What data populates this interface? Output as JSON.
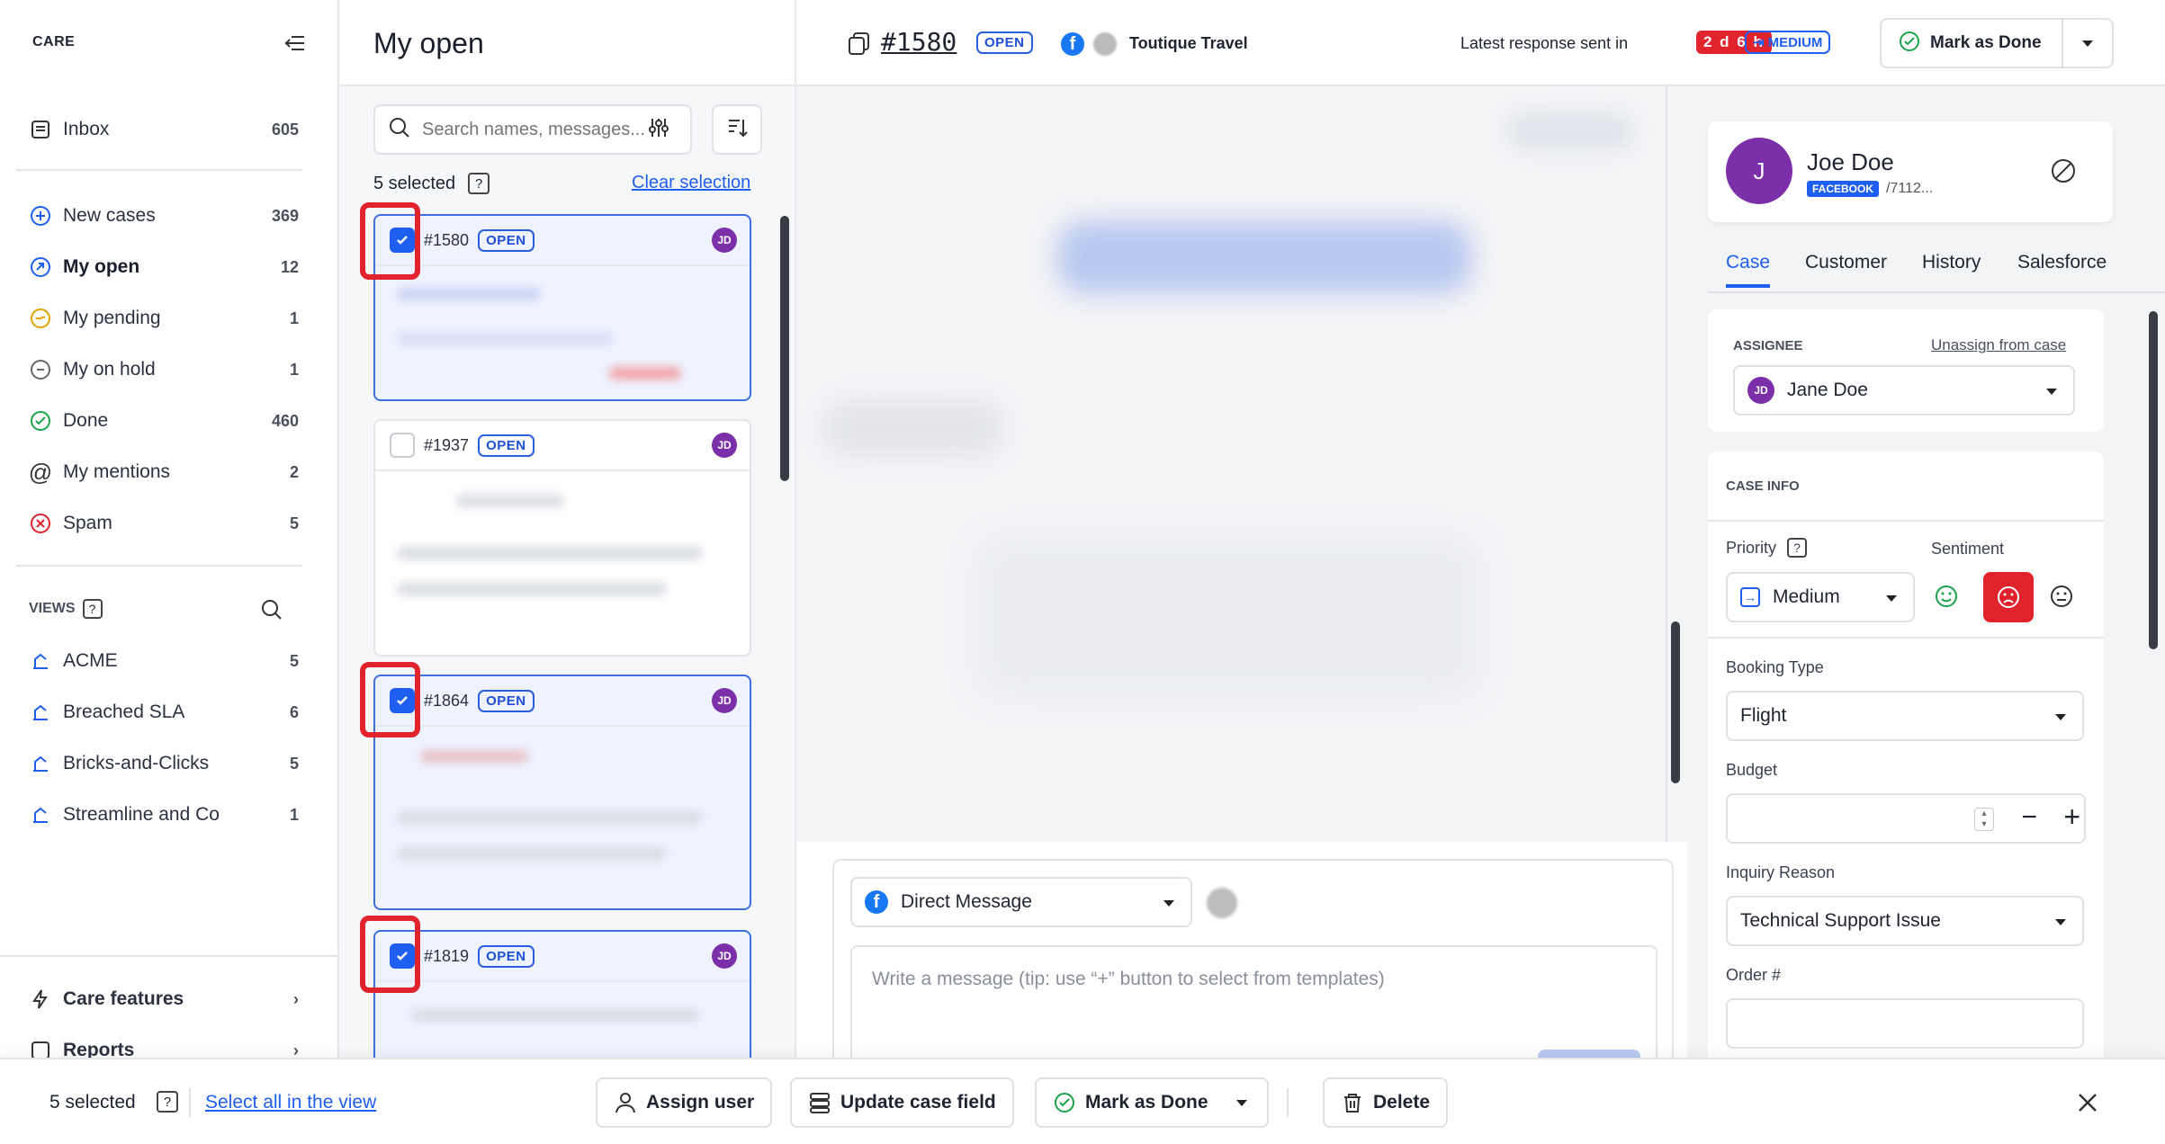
{
  "sidebar": {
    "title": "CARE",
    "items": [
      {
        "label": "Inbox",
        "count": "605"
      },
      {
        "label": "New cases",
        "count": "369"
      },
      {
        "label": "My open",
        "count": "12"
      },
      {
        "label": "My pending",
        "count": "1"
      },
      {
        "label": "My on hold",
        "count": "1"
      },
      {
        "label": "Done",
        "count": "460"
      },
      {
        "label": "My mentions",
        "count": "2"
      },
      {
        "label": "Spam",
        "count": "5"
      }
    ],
    "views_title": "VIEWS",
    "views": [
      {
        "label": "ACME",
        "count": "5"
      },
      {
        "label": "Breached SLA",
        "count": "6"
      },
      {
        "label": "Bricks-and-Clicks",
        "count": "5"
      },
      {
        "label": "Streamline and Co",
        "count": "1"
      }
    ],
    "footer": [
      {
        "label": "Care features"
      },
      {
        "label": "Reports"
      }
    ]
  },
  "list": {
    "title": "My open",
    "search_placeholder": "Search names, messages...",
    "selected_text": "5 selected",
    "clear_selection": "Clear selection",
    "cards": [
      {
        "num": "#1580",
        "status": "OPEN",
        "avatar": "JD"
      },
      {
        "num": "#1937",
        "status": "OPEN",
        "avatar": "JD"
      },
      {
        "num": "#1864",
        "status": "OPEN",
        "avatar": "JD"
      },
      {
        "num": "#1819",
        "status": "OPEN",
        "avatar": "JD"
      }
    ]
  },
  "header": {
    "case_id": "#1580",
    "status": "OPEN",
    "brand": "Toutique Travel",
    "response_label": "Latest response sent in",
    "response_time": "2 d 6 h",
    "priority_badge": "MEDIUM",
    "mark_done": "Mark as Done"
  },
  "composer": {
    "channel": "Direct Message",
    "placeholder": "Write a message (tip: use “+” button to select from templates)"
  },
  "contact": {
    "initial": "J",
    "name": "Joe Doe",
    "platform": "FACEBOOK",
    "handle": "/7112..."
  },
  "tabs": [
    "Case",
    "Customer",
    "History",
    "Salesforce"
  ],
  "assignee": {
    "label": "ASSIGNEE",
    "unassign": "Unassign from case",
    "initials": "JD",
    "name": "Jane Doe"
  },
  "case_info": {
    "title": "CASE INFO",
    "priority_label": "Priority",
    "priority_value": "Medium",
    "sentiment_label": "Sentiment",
    "booking_label": "Booking Type",
    "booking_value": "Flight",
    "budget_label": "Budget",
    "inquiry_label": "Inquiry Reason",
    "inquiry_value": "Technical Support Issue",
    "order_label": "Order #"
  },
  "bulk_bar": {
    "selected": "5 selected",
    "select_all": "Select all in the view",
    "assign": "Assign user",
    "update": "Update case field",
    "mark_done": "Mark as Done",
    "delete": "Delete"
  },
  "colors": {
    "accent": "#1e5ef0",
    "danger": "#e0232d",
    "purple": "#7b2fa8"
  }
}
